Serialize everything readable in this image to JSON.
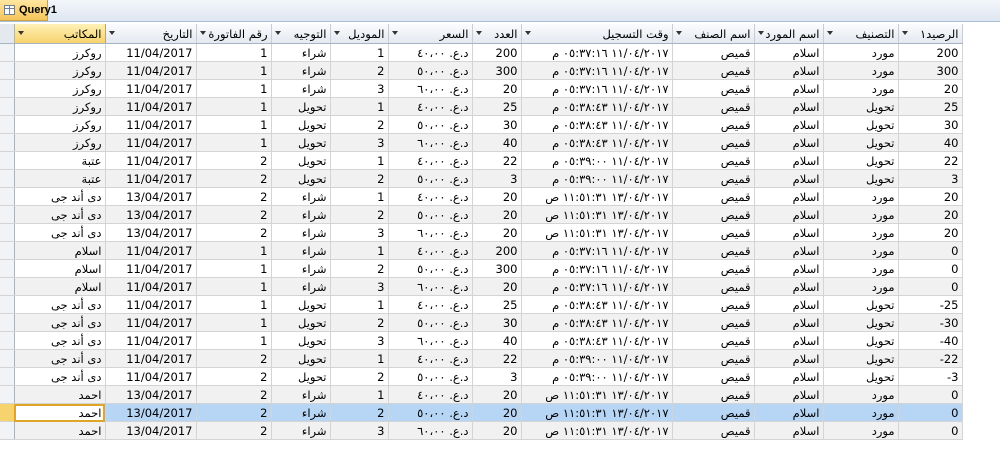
{
  "tab": {
    "label": "Query1",
    "icon": "query-table-icon"
  },
  "columns": [
    {
      "key": "office",
      "label": "المكاتب"
    },
    {
      "key": "date",
      "label": "التاريخ"
    },
    {
      "key": "invoice",
      "label": "رقم الفاتورة"
    },
    {
      "key": "direction",
      "label": "التوجيه"
    },
    {
      "key": "model",
      "label": "الموديل"
    },
    {
      "key": "price",
      "label": "السعر"
    },
    {
      "key": "qty",
      "label": "العدد"
    },
    {
      "key": "time",
      "label": "وقت التسجيل"
    },
    {
      "key": "item",
      "label": "اسم الصنف"
    },
    {
      "key": "supplier",
      "label": "اسم المورد"
    },
    {
      "key": "category",
      "label": "التصنيف"
    },
    {
      "key": "balance",
      "label": "الرصيد١"
    }
  ],
  "selected_row": 20,
  "rows": [
    [
      "روكرز",
      "11/04/2017",
      "1",
      "شراء",
      "1",
      "د.ع.‏ ٤٠،٠٠",
      "200",
      "١١/٠٤/٢٠١٧ ٠٥:٣٧:١٦ م",
      "قميص",
      "اسلام",
      "مورد",
      "200"
    ],
    [
      "روكرز",
      "11/04/2017",
      "1",
      "شراء",
      "2",
      "د.ع.‏ ٥٠،٠٠",
      "300",
      "١١/٠٤/٢٠١٧ ٠٥:٣٧:١٦ م",
      "قميص",
      "اسلام",
      "مورد",
      "300"
    ],
    [
      "روكرز",
      "11/04/2017",
      "1",
      "شراء",
      "3",
      "د.ع.‏ ٦٠،٠٠",
      "20",
      "١١/٠٤/٢٠١٧ ٠٥:٣٧:١٦ م",
      "قميص",
      "اسلام",
      "مورد",
      "20"
    ],
    [
      "روكرز",
      "11/04/2017",
      "1",
      "تحويل",
      "1",
      "د.ع.‏ ٤٠،٠٠",
      "25",
      "١١/٠٤/٢٠١٧ ٠٥:٣٨:٤٣ م",
      "قميص",
      "اسلام",
      "تحويل",
      "25"
    ],
    [
      "روكرز",
      "11/04/2017",
      "1",
      "تحويل",
      "2",
      "د.ع.‏ ٥٠،٠٠",
      "30",
      "١١/٠٤/٢٠١٧ ٠٥:٣٨:٤٣ م",
      "قميص",
      "اسلام",
      "تحويل",
      "30"
    ],
    [
      "روكرز",
      "11/04/2017",
      "1",
      "تحويل",
      "3",
      "د.ع.‏ ٦٠،٠٠",
      "40",
      "١١/٠٤/٢٠١٧ ٠٥:٣٨:٤٣ م",
      "قميص",
      "اسلام",
      "تحويل",
      "40"
    ],
    [
      "عتبة",
      "11/04/2017",
      "2",
      "تحويل",
      "1",
      "د.ع.‏ ٤٠،٠٠",
      "22",
      "١١/٠٤/٢٠١٧ ٠٥:٣٩:٠٠ م",
      "قميص",
      "اسلام",
      "تحويل",
      "22"
    ],
    [
      "عتبة",
      "11/04/2017",
      "2",
      "تحويل",
      "2",
      "د.ع.‏ ٥٠،٠٠",
      "3",
      "١١/٠٤/٢٠١٧ ٠٥:٣٩:٠٠ م",
      "قميص",
      "اسلام",
      "تحويل",
      "3"
    ],
    [
      "دى أند جى",
      "13/04/2017",
      "2",
      "شراء",
      "1",
      "د.ع.‏ ٤٠،٠٠",
      "20",
      "١٣/٠٤/٢٠١٧ ١١:٥١:٣١ ص",
      "قميص",
      "اسلام",
      "مورد",
      "20"
    ],
    [
      "دى أند جى",
      "13/04/2017",
      "2",
      "شراء",
      "2",
      "د.ع.‏ ٥٠،٠٠",
      "20",
      "١٣/٠٤/٢٠١٧ ١١:٥١:٣١ ص",
      "قميص",
      "اسلام",
      "مورد",
      "20"
    ],
    [
      "دى أند جى",
      "13/04/2017",
      "2",
      "شراء",
      "3",
      "د.ع.‏ ٦٠،٠٠",
      "20",
      "١٣/٠٤/٢٠١٧ ١١:٥١:٣١ ص",
      "قميص",
      "اسلام",
      "مورد",
      "20"
    ],
    [
      "اسلام",
      "11/04/2017",
      "1",
      "شراء",
      "1",
      "د.ع.‏ ٤٠،٠٠",
      "200",
      "١١/٠٤/٢٠١٧ ٠٥:٣٧:١٦ م",
      "قميص",
      "اسلام",
      "مورد",
      "0"
    ],
    [
      "اسلام",
      "11/04/2017",
      "1",
      "شراء",
      "2",
      "د.ع.‏ ٥٠،٠٠",
      "300",
      "١١/٠٤/٢٠١٧ ٠٥:٣٧:١٦ م",
      "قميص",
      "اسلام",
      "مورد",
      "0"
    ],
    [
      "اسلام",
      "11/04/2017",
      "1",
      "شراء",
      "3",
      "د.ع.‏ ٦٠،٠٠",
      "20",
      "١١/٠٤/٢٠١٧ ٠٥:٣٧:١٦ م",
      "قميص",
      "اسلام",
      "مورد",
      "0"
    ],
    [
      "دى أند جى",
      "11/04/2017",
      "1",
      "تحويل",
      "1",
      "د.ع.‏ ٤٠،٠٠",
      "25",
      "١١/٠٤/٢٠١٧ ٠٥:٣٨:٤٣ م",
      "قميص",
      "اسلام",
      "تحويل",
      "-25"
    ],
    [
      "دى أند جى",
      "11/04/2017",
      "1",
      "تحويل",
      "2",
      "د.ع.‏ ٥٠،٠٠",
      "30",
      "١١/٠٤/٢٠١٧ ٠٥:٣٨:٤٣ م",
      "قميص",
      "اسلام",
      "تحويل",
      "-30"
    ],
    [
      "دى أند جى",
      "11/04/2017",
      "1",
      "تحويل",
      "3",
      "د.ع.‏ ٦٠،٠٠",
      "40",
      "١١/٠٤/٢٠١٧ ٠٥:٣٨:٤٣ م",
      "قميص",
      "اسلام",
      "تحويل",
      "-40"
    ],
    [
      "دى أند جى",
      "11/04/2017",
      "2",
      "تحويل",
      "1",
      "د.ع.‏ ٤٠،٠٠",
      "22",
      "١١/٠٤/٢٠١٧ ٠٥:٣٩:٠٠ م",
      "قميص",
      "اسلام",
      "تحويل",
      "-22"
    ],
    [
      "دى أند جى",
      "11/04/2017",
      "2",
      "تحويل",
      "2",
      "د.ع.‏ ٥٠،٠٠",
      "3",
      "١١/٠٤/٢٠١٧ ٠٥:٣٩:٠٠ م",
      "قميص",
      "اسلام",
      "تحويل",
      "-3"
    ],
    [
      "احمد",
      "13/04/2017",
      "2",
      "شراء",
      "1",
      "د.ع.‏ ٤٠،٠٠",
      "20",
      "١٣/٠٤/٢٠١٧ ١١:٥١:٣١ ص",
      "قميص",
      "اسلام",
      "مورد",
      "0"
    ],
    [
      "احمد",
      "13/04/2017",
      "2",
      "شراء",
      "2",
      "د.ع.‏ ٥٠،٠٠",
      "20",
      "١٣/٠٤/٢٠١٧ ١١:٥١:٣١ ص",
      "قميص",
      "اسلام",
      "مورد",
      "0"
    ],
    [
      "احمد",
      "13/04/2017",
      "2",
      "شراء",
      "3",
      "د.ع.‏ ٦٠،٠٠",
      "20",
      "١٣/٠٤/٢٠١٧ ١١:٥١:٣١ ص",
      "قميص",
      "اسلام",
      "مورد",
      "0"
    ]
  ]
}
